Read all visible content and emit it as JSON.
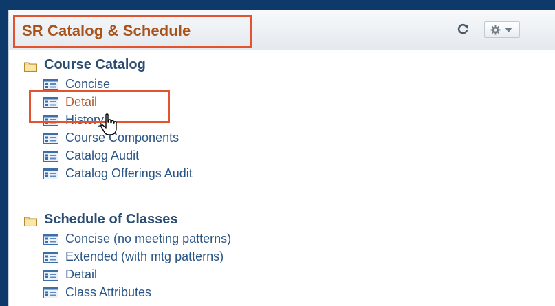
{
  "header": {
    "title": "SR Catalog & Schedule",
    "refresh_icon": "refresh-icon",
    "options_icon": "gear-icon"
  },
  "sections": [
    {
      "title": "Course Catalog",
      "icon": "folder-icon",
      "items": [
        {
          "label": "Concise"
        },
        {
          "label": "Detail",
          "active": true
        },
        {
          "label": "History"
        },
        {
          "label": "Course Components"
        },
        {
          "label": "Catalog Audit"
        },
        {
          "label": "Catalog Offerings Audit"
        }
      ]
    },
    {
      "title": "Schedule of Classes",
      "icon": "folder-icon",
      "items": [
        {
          "label": "Concise (no meeting patterns)"
        },
        {
          "label": "Extended (with mtg patterns)"
        },
        {
          "label": "Detail"
        },
        {
          "label": "Class Attributes"
        }
      ]
    }
  ],
  "colors": {
    "highlight": "#e2532f",
    "title": "#a9531c",
    "link": "#2a5587",
    "active_link": "#b4582a",
    "frame": "#0d3a6a"
  }
}
